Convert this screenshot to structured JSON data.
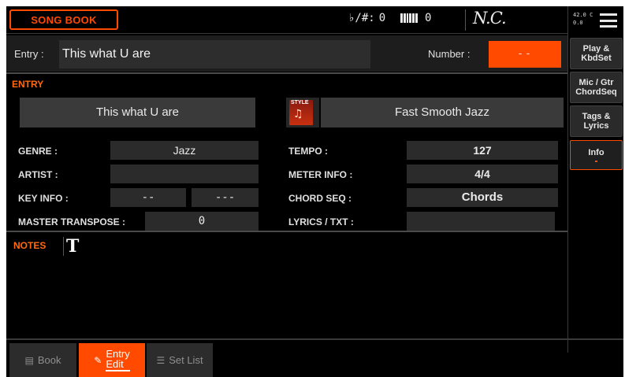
{
  "header": {
    "title": "SONG BOOK",
    "transpose_symbol": "♭/#:",
    "transpose_value": "0",
    "octave_value": "0",
    "chord": "N.C.",
    "temperature": "42.0 C",
    "temp_sub": "0.0"
  },
  "entry_row": {
    "entry_label": "Entry :",
    "entry_value": "This what U are",
    "number_label": "Number :",
    "number_value": "--"
  },
  "side_tabs": [
    {
      "label_line1": "Play &",
      "label_line2": "KbdSet"
    },
    {
      "label_line1": "Mic / Gtr",
      "label_line2": "ChordSeq"
    },
    {
      "label_line1": "Tags &",
      "label_line2": "Lyrics"
    },
    {
      "label_line1": "Info",
      "label_line2": ""
    }
  ],
  "entry_section": {
    "title": "ENTRY",
    "song_name": "This what U are",
    "style_icon_label": "STYLE",
    "style_name": "Fast Smooth Jazz",
    "genre_label": "GENRE :",
    "genre_value": "Jazz",
    "artist_label": "ARTIST :",
    "artist_value": "",
    "key_label": "KEY INFO :",
    "key_value_1": "--",
    "key_value_2": "---",
    "master_label": "MASTER TRANSPOSE :",
    "master_value": "0",
    "tempo_label": "TEMPO :",
    "tempo_value": "127",
    "meter_label": "METER INFO :",
    "meter_value": "4/4",
    "chordseq_label": "CHORD SEQ :",
    "chordseq_value": "Chords",
    "lyrics_label": "LYRICS / TXT :",
    "lyrics_value": ""
  },
  "notes": {
    "title": "NOTES",
    "icon": "T"
  },
  "bottom_tabs": {
    "book_label": "Book",
    "entry_edit_line1": "Entry",
    "entry_edit_line2": "Edit",
    "setlist_label": "Set List"
  },
  "colors": {
    "accent": "#ff4a00",
    "panel": "#000000",
    "field": "#2b2b2b"
  }
}
